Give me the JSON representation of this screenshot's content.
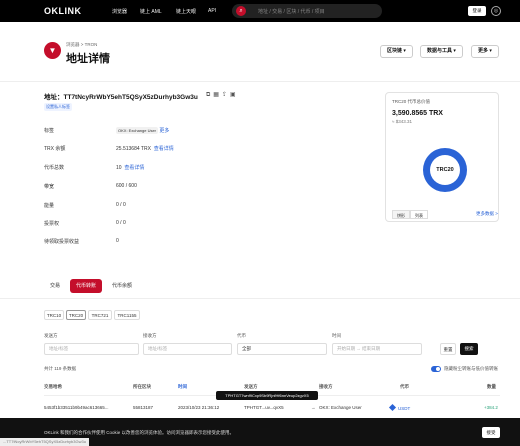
{
  "nav": {
    "logo": "OKLINK",
    "items": [
      "浏览器",
      "链上 AML",
      "链上天眼",
      "API"
    ],
    "search_placeholder": "地址 / 交易 / 区块 / 代币 / 项目",
    "login": "登录",
    "lang_icon": "globe-icon"
  },
  "header": {
    "breadcrumb": "浏览器 > TRON",
    "title": "地址详情",
    "buttons": [
      "区块链 ▾",
      "数据与工具 ▾",
      "更多 ▾"
    ]
  },
  "address": {
    "label": "地址：TT7tNcyRrWbY5ehT5QSyX5zDurhyb3Gw3u",
    "tag": "设置私人标签"
  },
  "info": [
    {
      "key": "标签",
      "chip": "OKX: Exchange User",
      "link": "更多"
    },
    {
      "key": "TRX 余额",
      "value": "25.513684 TRX",
      "link": "查看详情"
    },
    {
      "key": "代币总数",
      "value": "10",
      "link": "查看详情"
    },
    {
      "key": "带宽",
      "value": "600  /  600"
    },
    {
      "key": "能量",
      "value": "0  /  0"
    },
    {
      "key": "投票权",
      "value": "0  /  0"
    },
    {
      "key": "待领取投票收益",
      "value": "0"
    }
  ],
  "card": {
    "title": "TRC20 代币总价值",
    "amount": "3,590.8565 TRX",
    "usd": "≈ $343.31",
    "donut_label": "TRC20",
    "seg": [
      "饼形",
      "列表"
    ],
    "more": "更多数据 >"
  },
  "tabs": [
    "交易",
    "代币转账",
    "代币余额"
  ],
  "subtabs": [
    "TRC10",
    "TRC20",
    "TRC721",
    "TRC1155"
  ],
  "filters": {
    "labels": [
      "发送方",
      "接收方",
      "代币",
      "时间"
    ],
    "placeholders": [
      "地址/标签",
      "地址/标签",
      "全部",
      "开始日期  →  结束日期"
    ],
    "reset": "重置",
    "search": "搜索"
  },
  "stats": "共计 119 条数据",
  "toggle_label": "隐藏粉尘转账与低价值转账",
  "table": {
    "headers": [
      "交易哈希",
      "所在区块",
      "时间",
      "发送方",
      "接收方",
      "代币",
      "数量"
    ],
    "row": {
      "hash": "5453f1b33511b9b49ac613665...",
      "block": "55813187",
      "time": "2023/10/23 21:36:12",
      "from": "TPHTGT...uv...qvX5",
      "to": "OKX: Exchange User",
      "token": "USDT",
      "amount": "+384.2"
    },
    "tooltip": "TPHTGT7wnf9Cxp9Sb9RjnfHf6nnVeup2zgvX5"
  },
  "cookie": {
    "text": "OKLink 和我们的合作伙伴使用 Cookie 以改善您的浏览体验。访问浏览器即表示您接受此使用。",
    "button": "接受"
  },
  "status_url": "...TT7tNcyRrWbY5ehT5QSyX5zDurhyb3Gw3u"
}
